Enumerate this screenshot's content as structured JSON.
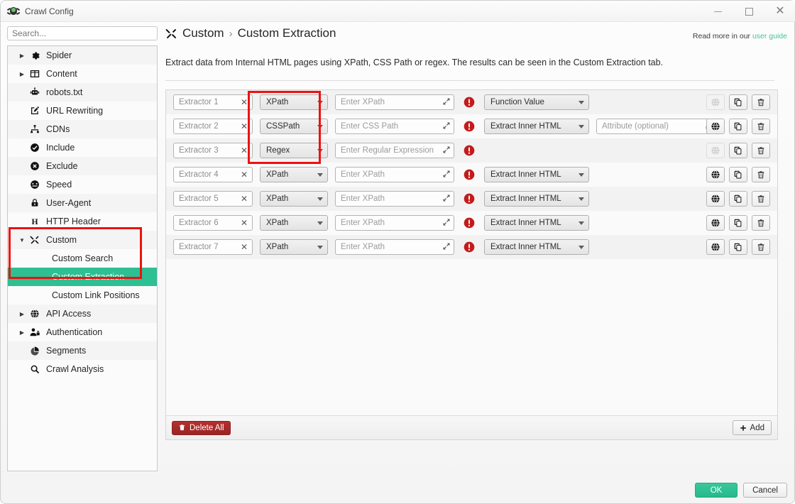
{
  "window": {
    "title": "Crawl Config",
    "logo_icon": "spider-icon",
    "minimize_label": "–",
    "maximize_label": "□",
    "close_label": "×"
  },
  "sidebar": {
    "search": {
      "placeholder": "Search...",
      "value": ""
    },
    "items": [
      {
        "label": "Spider",
        "icon": "gear-icon",
        "arrow": "right",
        "level": 0,
        "selected": false
      },
      {
        "label": "Content",
        "icon": "columns-icon",
        "arrow": "right",
        "level": 0,
        "selected": false
      },
      {
        "label": "robots.txt",
        "icon": "robot-icon",
        "arrow": "none",
        "level": 0,
        "selected": false
      },
      {
        "label": "URL Rewriting",
        "icon": "edit-square-icon",
        "arrow": "none",
        "level": 0,
        "selected": false
      },
      {
        "label": "CDNs",
        "icon": "sitemap-icon",
        "arrow": "none",
        "level": 0,
        "selected": false
      },
      {
        "label": "Include",
        "icon": "check-circle-icon",
        "arrow": "none",
        "level": 0,
        "selected": false
      },
      {
        "label": "Exclude",
        "icon": "x-circle-icon",
        "arrow": "none",
        "level": 0,
        "selected": false
      },
      {
        "label": "Speed",
        "icon": "gauge-icon",
        "arrow": "none",
        "level": 0,
        "selected": false
      },
      {
        "label": "User-Agent",
        "icon": "lock-icon",
        "arrow": "none",
        "level": 0,
        "selected": false
      },
      {
        "label": "HTTP Header",
        "icon": "letter-h-icon",
        "arrow": "none",
        "level": 0,
        "selected": false
      },
      {
        "label": "Custom",
        "icon": "tools-icon",
        "arrow": "down",
        "level": 0,
        "selected": false
      },
      {
        "label": "Custom Search",
        "icon": "none",
        "arrow": "none",
        "level": 1,
        "selected": false
      },
      {
        "label": "Custom Extraction",
        "icon": "none",
        "arrow": "none",
        "level": 1,
        "selected": true
      },
      {
        "label": "Custom Link Positions",
        "icon": "none",
        "arrow": "none",
        "level": 1,
        "selected": false
      },
      {
        "label": "API Access",
        "icon": "globe-icon",
        "arrow": "right",
        "level": 0,
        "selected": false
      },
      {
        "label": "Authentication",
        "icon": "user-lock-icon",
        "arrow": "right",
        "level": 0,
        "selected": false
      },
      {
        "label": "Segments",
        "icon": "pie-chart-icon",
        "arrow": "none",
        "level": 0,
        "selected": false
      },
      {
        "label": "Crawl Analysis",
        "icon": "magnifier-icon",
        "arrow": "none",
        "level": 0,
        "selected": false
      }
    ]
  },
  "header": {
    "icon": "tools-icon",
    "breadcrumb_parent": "Custom",
    "breadcrumb_separator": "›",
    "breadcrumb_current": "Custom Extraction",
    "read_more_prefix": "Read more in our",
    "read_more_link": "user guide",
    "description": "Extract data from Internal HTML pages using XPath, CSS Path or regex. The results can be seen in the Custom Extraction tab."
  },
  "extractors": [
    {
      "name": "Extractor 1",
      "clear_icon": "close-icon",
      "type": "XPath",
      "query_placeholder": "Enter XPath",
      "query_value": "",
      "expand_icon": "expand-icon",
      "error_icon": "error-icon",
      "action": "Function Value",
      "attribute_placeholder": null,
      "has_attribute": false,
      "browse_enabled": false,
      "browse_icon": "globe-icon",
      "copy_icon": "copy-icon",
      "delete_icon": "trash-icon"
    },
    {
      "name": "Extractor 2",
      "clear_icon": "close-icon",
      "type": "CSSPath",
      "query_placeholder": "Enter CSS Path",
      "query_value": "",
      "expand_icon": "expand-icon",
      "error_icon": "error-icon",
      "action": "Extract Inner HTML",
      "attribute_placeholder": "Attribute (optional)",
      "has_attribute": true,
      "browse_enabled": true,
      "browse_icon": "globe-icon",
      "copy_icon": "copy-icon",
      "delete_icon": "trash-icon"
    },
    {
      "name": "Extractor 3",
      "clear_icon": "close-icon",
      "type": "Regex",
      "query_placeholder": "Enter Regular Expression",
      "query_value": "",
      "expand_icon": "expand-icon",
      "error_icon": "error-icon",
      "action": null,
      "attribute_placeholder": null,
      "has_attribute": false,
      "browse_enabled": false,
      "browse_icon": "globe-icon",
      "copy_icon": "copy-icon",
      "delete_icon": "trash-icon"
    },
    {
      "name": "Extractor 4",
      "clear_icon": "close-icon",
      "type": "XPath",
      "query_placeholder": "Enter XPath",
      "query_value": "",
      "expand_icon": "expand-icon",
      "error_icon": "error-icon",
      "action": "Extract Inner HTML",
      "attribute_placeholder": null,
      "has_attribute": false,
      "browse_enabled": true,
      "browse_icon": "globe-icon",
      "copy_icon": "copy-icon",
      "delete_icon": "trash-icon"
    },
    {
      "name": "Extractor 5",
      "clear_icon": "close-icon",
      "type": "XPath",
      "query_placeholder": "Enter XPath",
      "query_value": "",
      "expand_icon": "expand-icon",
      "error_icon": "error-icon",
      "action": "Extract Inner HTML",
      "attribute_placeholder": null,
      "has_attribute": false,
      "browse_enabled": true,
      "browse_icon": "globe-icon",
      "copy_icon": "copy-icon",
      "delete_icon": "trash-icon"
    },
    {
      "name": "Extractor 6",
      "clear_icon": "close-icon",
      "type": "XPath",
      "query_placeholder": "Enter XPath",
      "query_value": "",
      "expand_icon": "expand-icon",
      "error_icon": "error-icon",
      "action": "Extract Inner HTML",
      "attribute_placeholder": null,
      "has_attribute": false,
      "browse_enabled": true,
      "browse_icon": "globe-icon",
      "copy_icon": "copy-icon",
      "delete_icon": "trash-icon"
    },
    {
      "name": "Extractor 7",
      "clear_icon": "close-icon",
      "type": "XPath",
      "query_placeholder": "Enter XPath",
      "query_value": "",
      "expand_icon": "expand-icon",
      "error_icon": "error-icon",
      "action": "Extract Inner HTML",
      "attribute_placeholder": null,
      "has_attribute": false,
      "browse_enabled": true,
      "browse_icon": "globe-icon",
      "copy_icon": "copy-icon",
      "delete_icon": "trash-icon"
    }
  ],
  "grid_footer": {
    "delete_all_label": "Delete All",
    "delete_all_icon": "trash-icon",
    "add_label": "Add",
    "add_icon": "plus-icon"
  },
  "dialog_footer": {
    "ok_label": "OK",
    "cancel_label": "Cancel"
  },
  "annotations": [
    {
      "name": "sidebar-custom-highlight"
    },
    {
      "name": "type-column-highlight"
    }
  ],
  "colors": {
    "accent_green": "#2ebf92",
    "ok_green": "#27b98b",
    "annotation_red": "#ee1111",
    "delete_red": "#992524",
    "error_red": "#c31b1b",
    "link_green": "#45c49a"
  }
}
